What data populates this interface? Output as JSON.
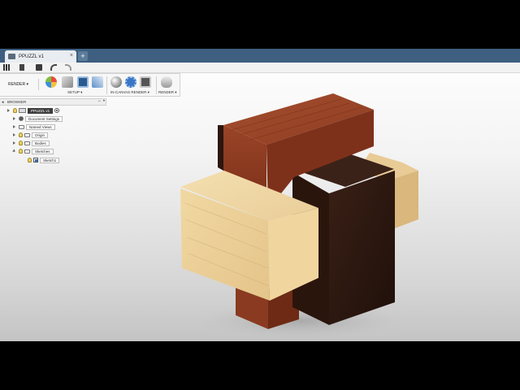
{
  "document": {
    "tab_title": "PPUZZL v1",
    "close_glyph": "×",
    "new_tab_glyph": "+"
  },
  "toolbar": {
    "workspace_label": "RENDER ▾",
    "groups": [
      {
        "label": "SETUP ▾"
      },
      {
        "label": "IN-CANVAS RENDER ▾"
      },
      {
        "label": "RENDER ▾"
      }
    ]
  },
  "browser": {
    "title": "BROWSER",
    "collapse_glyph": "◂",
    "minimize_glyph": "−",
    "pin_glyph": "•",
    "root": "PPUZZL v1",
    "items": [
      {
        "label": "Document Settings",
        "icon": "gear-icon"
      },
      {
        "label": "Named Views",
        "icon": "folder-icon"
      },
      {
        "label": "Origin",
        "icon": "folder-icon"
      },
      {
        "label": "Bodies",
        "icon": "folder-icon"
      },
      {
        "label": "Sketches",
        "icon": "folder-icon"
      }
    ],
    "sub_items": [
      {
        "label": "Sketch1",
        "icon": "sketch-icon"
      }
    ]
  },
  "scene": {
    "description_icon": "wooden-burr-puzzle-model",
    "wood_colors": {
      "mahogany": "#8b3a22",
      "dark_walnut": "#2a1610",
      "light_maple": "#e6c890"
    }
  },
  "colors": {
    "tabbar": "#3e5f80",
    "toolbar": "#f7f7f7",
    "viewport_top": "#ffffff",
    "viewport_bottom": "#c4c4c4"
  }
}
